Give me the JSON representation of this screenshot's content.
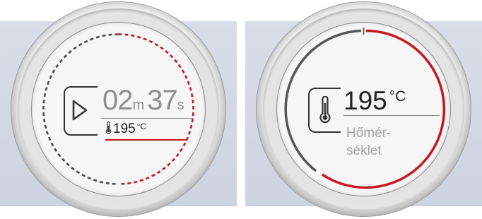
{
  "timer": {
    "minutes": "02",
    "minutes_unit": "m",
    "seconds": "37",
    "seconds_unit": "s"
  },
  "temperature": {
    "value": "195",
    "unit": "°C"
  },
  "temperature_label": {
    "line1": "Hőmér-",
    "line2": "séklet"
  },
  "icons": {
    "play": "play-icon",
    "thermometer": "thermometer-icon"
  },
  "colors": {
    "accent_red": "#c8161e",
    "ring_gray": "#555555",
    "strip": "#d3d8e4"
  }
}
